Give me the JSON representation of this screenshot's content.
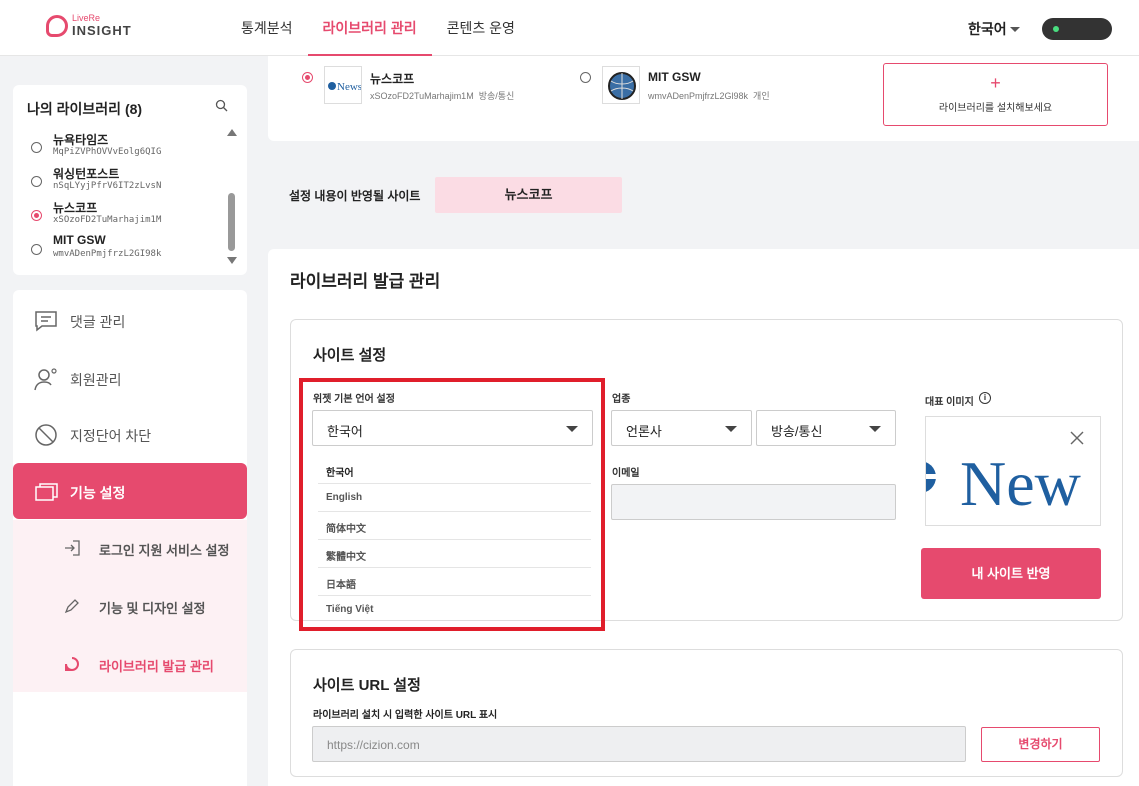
{
  "header": {
    "logo_small": "LiveRe",
    "logo_text": "INSIGHT",
    "nav": [
      {
        "label": "통계분석"
      },
      {
        "label": "라이브러리 관리"
      },
      {
        "label": "콘텐츠 운영"
      }
    ],
    "active_nav": 1,
    "language": "한국어"
  },
  "library": {
    "title": "나의 라이브러리 (8)",
    "items": [
      {
        "name": "뉴욕타임즈",
        "key": "MqPiZVPhOVVvEolg6QIG",
        "selected": false
      },
      {
        "name": "워싱턴포스트",
        "key": "nSqLYyjPfrV6IT2zLvsN",
        "selected": false
      },
      {
        "name": "뉴스코프",
        "key": "xSOzoFD2TuMarhajim1M",
        "selected": true
      },
      {
        "name": "MIT GSW",
        "key": "wmvADenPmjfrzL2GI98k",
        "selected": false
      }
    ]
  },
  "menu": {
    "items": [
      {
        "label": "댓글 관리"
      },
      {
        "label": "회원관리"
      },
      {
        "label": "지정단어 차단"
      },
      {
        "label": "기능 설정"
      }
    ],
    "sub_items": [
      {
        "label": "로그인 지원 서비스 설정"
      },
      {
        "label": "기능 및 디자인 설정"
      },
      {
        "label": "라이브러리 발급 관리"
      }
    ]
  },
  "picker": {
    "items": [
      {
        "name": "뉴스코프",
        "key": "xSOzoFD2TuMarhajim1M",
        "type": "방송/통신",
        "logo_text": "News",
        "selected": true
      },
      {
        "name": "MIT GSW",
        "key": "wmvADenPmjfrzL2Gl98k",
        "type": "개인",
        "selected": false
      }
    ],
    "install_label": "라이브러리를 설치해보세요",
    "install_plus": "+"
  },
  "applied": {
    "label": "설정 내용이 반영될 사이트",
    "site": "뉴스코프"
  },
  "issue": {
    "title": "라이브러리 발급 관리",
    "site_settings": {
      "title": "사이트 설정",
      "language_label": "위젯 기본 언어 설정",
      "language_value": "한국어",
      "language_options": [
        "한국어",
        "English",
        "简体中文",
        "繁體中文",
        "日本語",
        "Tiếng Việt"
      ],
      "industry_label": "업종",
      "industry_value": "언론사",
      "category_value": "방송/통신",
      "email_label": "이메일",
      "image_label": "대표 이미지",
      "image_text": "New",
      "info_glyph": "i",
      "apply_label": "내 사이트 반영"
    },
    "url_settings": {
      "title": "사이트 URL 설정",
      "label": "라이브러리 설치 시 입력한 사이트 URL 표시",
      "url": "https://cizion.com",
      "change_label": "변경하기"
    }
  },
  "colors": {
    "accent": "#e64a6e",
    "highlight": "#e01e2b"
  }
}
